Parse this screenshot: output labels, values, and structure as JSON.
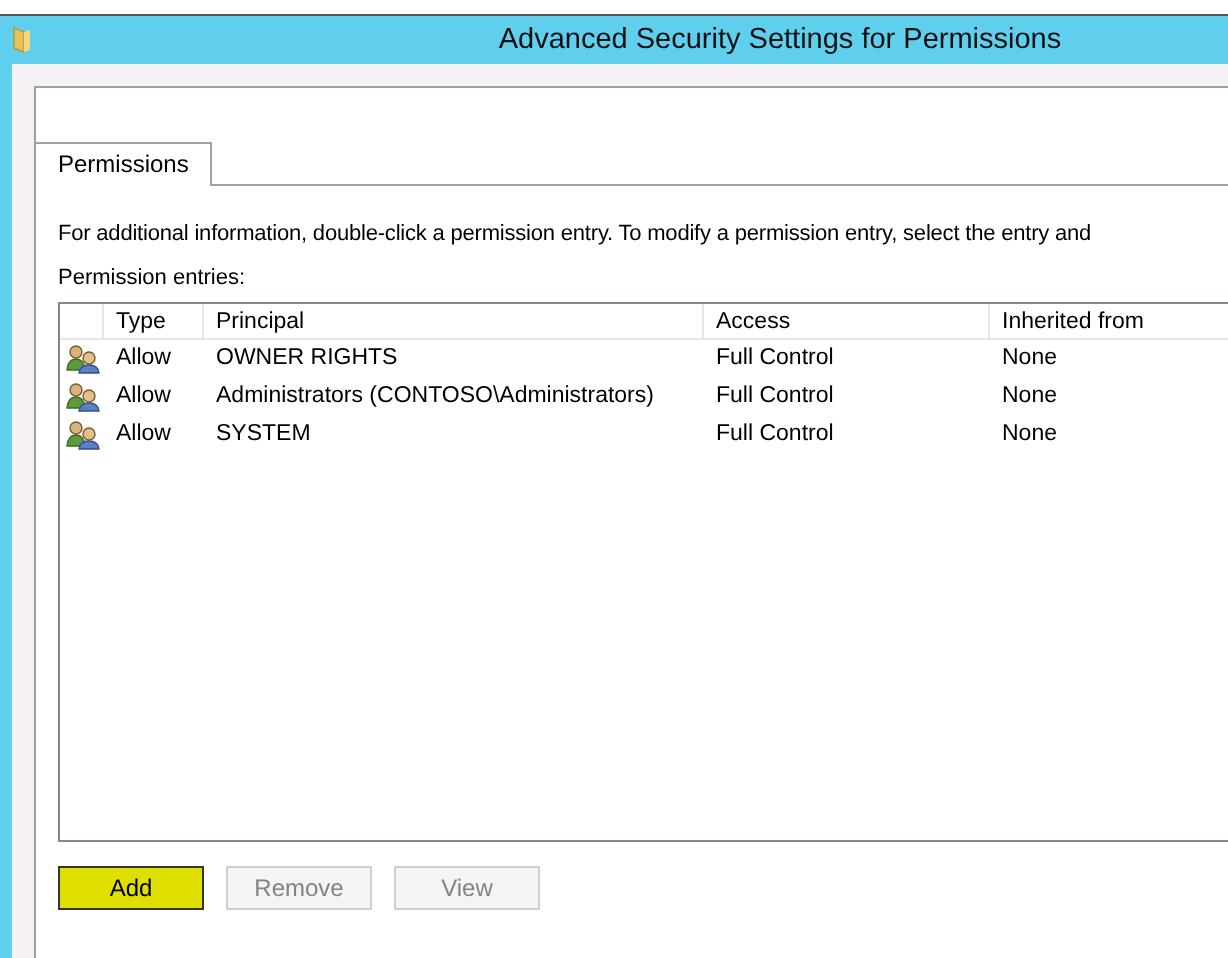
{
  "window": {
    "title": "Advanced Security Settings for Permissions"
  },
  "tabs": [
    {
      "label": "Permissions",
      "selected": true
    }
  ],
  "info_text": "For additional information, double-click a permission entry. To modify a permission entry, select the entry and",
  "entries_label": "Permission entries:",
  "table": {
    "columns": [
      "Type",
      "Principal",
      "Access",
      "Inherited from"
    ],
    "rows": [
      {
        "type": "Allow",
        "principal": "OWNER RIGHTS",
        "access": "Full Control",
        "inherited_from": "None"
      },
      {
        "type": "Allow",
        "principal": "Administrators (CONTOSO\\Administrators)",
        "access": "Full Control",
        "inherited_from": "None"
      },
      {
        "type": "Allow",
        "principal": "SYSTEM",
        "access": "Full Control",
        "inherited_from": "None"
      }
    ]
  },
  "buttons": [
    {
      "label": "Add",
      "disabled": false,
      "highlighted": true
    },
    {
      "label": "Remove",
      "disabled": true,
      "highlighted": false
    },
    {
      "label": "View",
      "disabled": true,
      "highlighted": false
    }
  ]
}
